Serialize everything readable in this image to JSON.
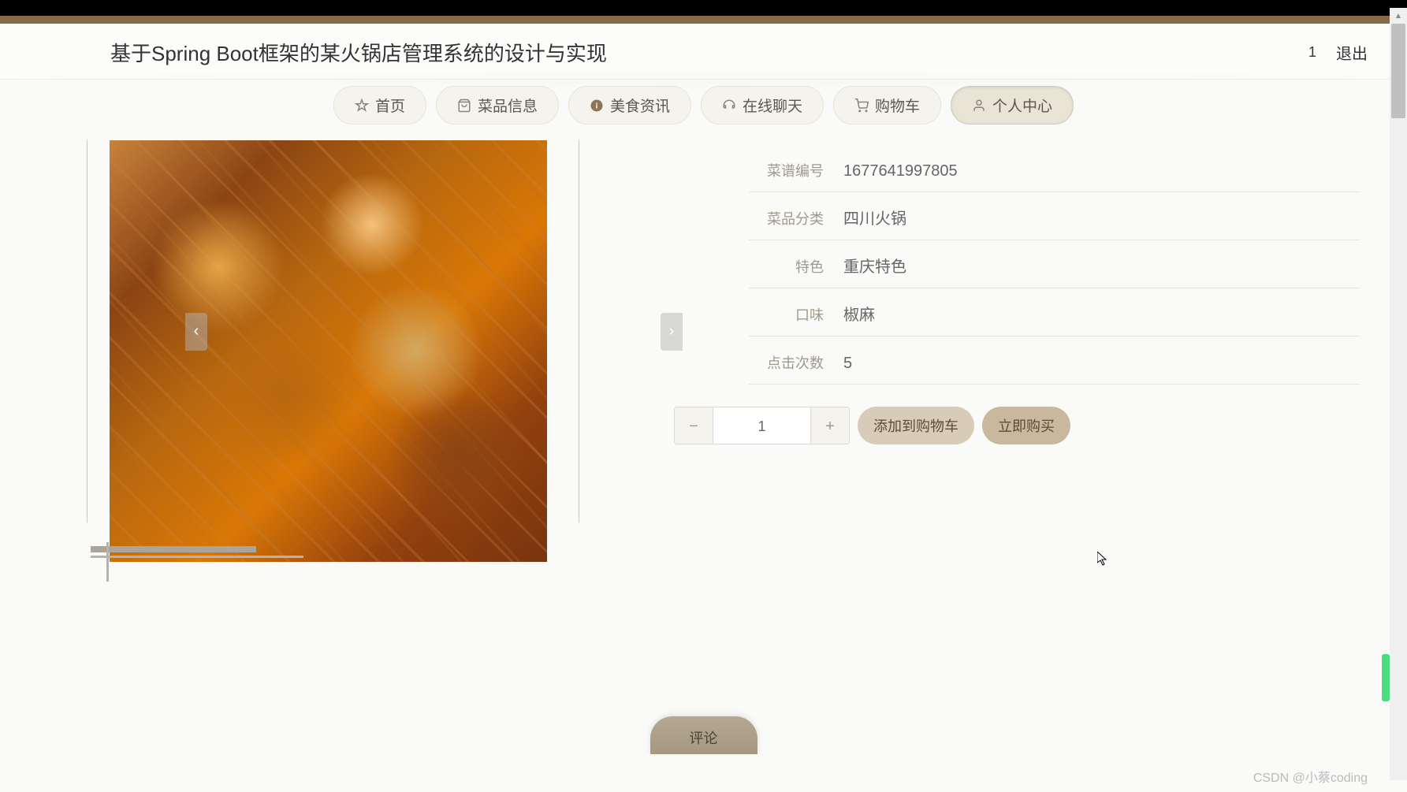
{
  "header": {
    "title": "基于Spring Boot框架的某火锅店管理系统的设计与实现",
    "user_count": "1",
    "logout": "退出"
  },
  "nav": {
    "items": [
      {
        "label": "首页",
        "icon": "star"
      },
      {
        "label": "菜品信息",
        "icon": "bag"
      },
      {
        "label": "美食资讯",
        "icon": "info"
      },
      {
        "label": "在线聊天",
        "icon": "headset"
      },
      {
        "label": "购物车",
        "icon": "cart"
      },
      {
        "label": "个人中心",
        "icon": "user",
        "active": true
      }
    ]
  },
  "details": {
    "rows": [
      {
        "label": "菜谱编号",
        "value": "1677641997805"
      },
      {
        "label": "菜品分类",
        "value": "四川火锅"
      },
      {
        "label": "特色",
        "value": "重庆特色"
      },
      {
        "label": "口味",
        "value": "椒麻"
      },
      {
        "label": "点击次数",
        "value": "5"
      }
    ]
  },
  "actions": {
    "quantity": "1",
    "add_to_cart": "添加到购物车",
    "buy_now": "立即购买"
  },
  "comment_tab": "评论",
  "watermark": "CSDN @小蔡coding"
}
